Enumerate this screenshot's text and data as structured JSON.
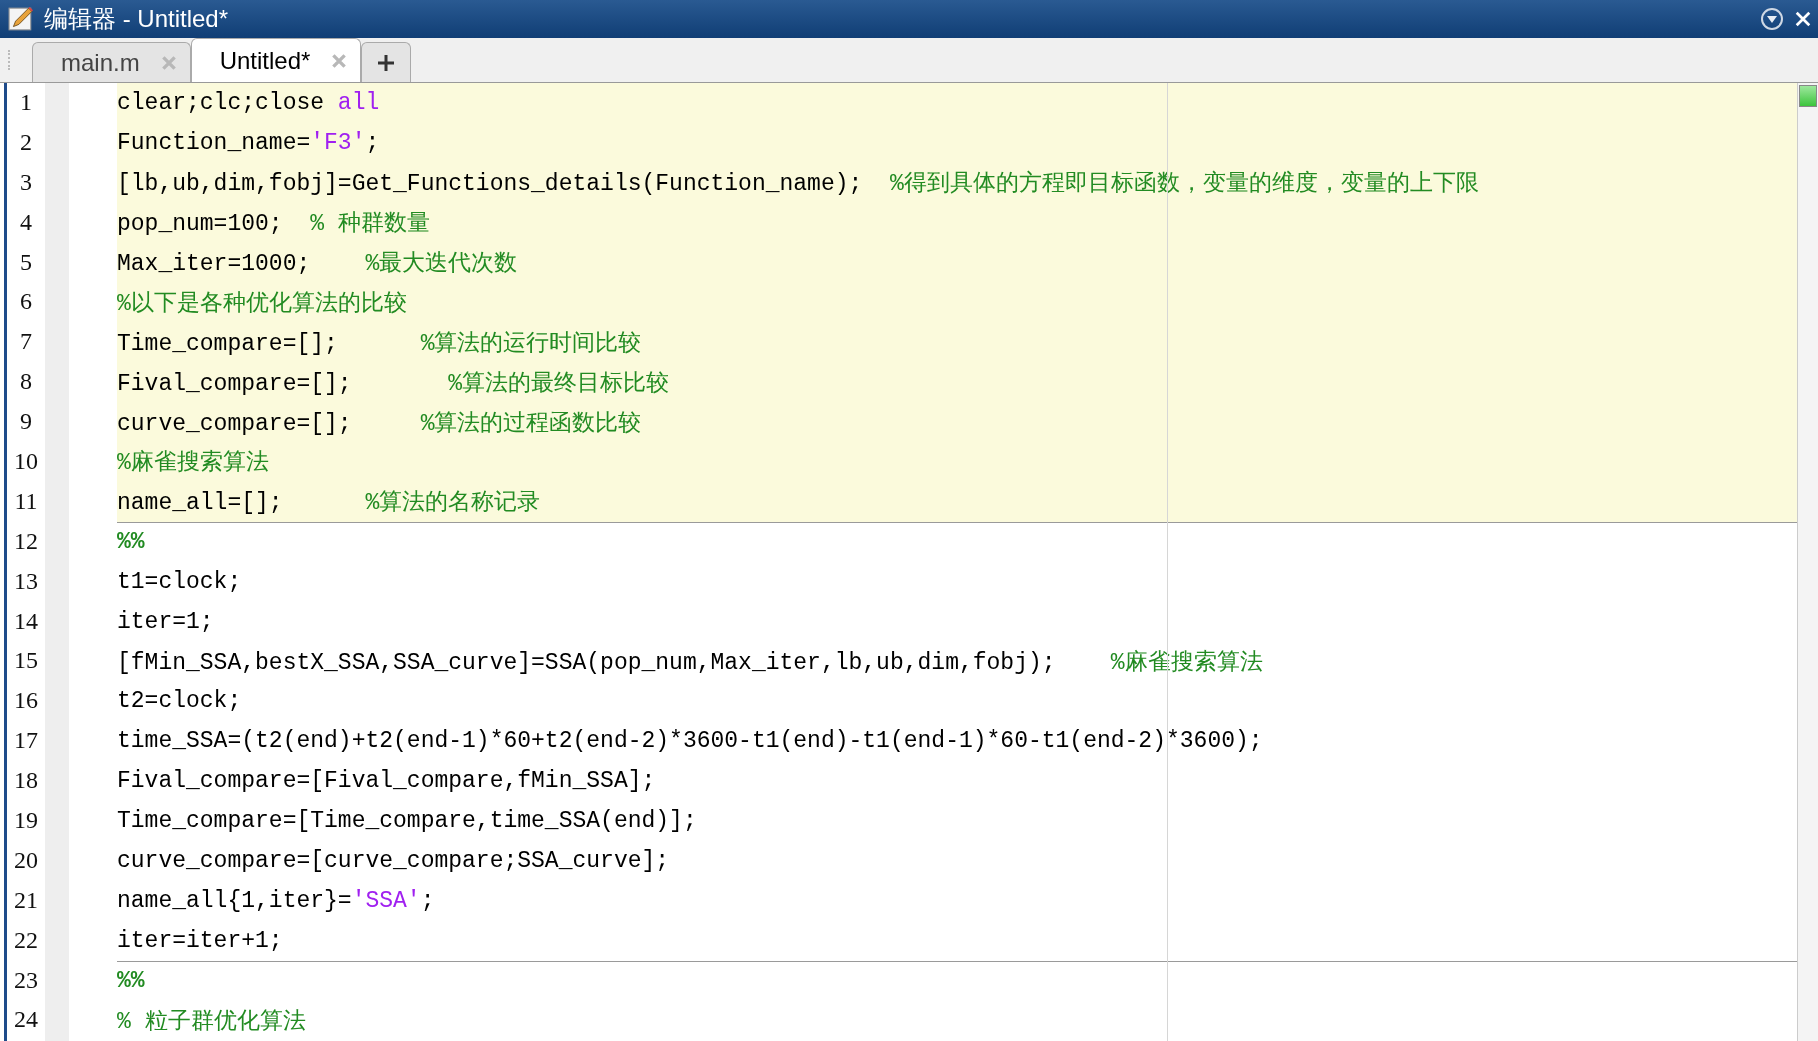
{
  "window": {
    "title": "编辑器 - Untitled*"
  },
  "tabs": [
    {
      "label": "main.m",
      "selected": false
    },
    {
      "label": "Untitled*",
      "selected": true
    }
  ],
  "lines": [
    {
      "number": "1",
      "highlighted": true,
      "tokens": [
        {
          "kind": "code",
          "text": "clear;clc;close "
        },
        {
          "kind": "string",
          "text": "all"
        }
      ]
    },
    {
      "number": "2",
      "highlighted": true,
      "tokens": [
        {
          "kind": "code",
          "text": "Function_name="
        },
        {
          "kind": "string",
          "text": "'F3'"
        },
        {
          "kind": "code",
          "text": ";"
        }
      ]
    },
    {
      "number": "3",
      "highlighted": true,
      "tokens": [
        {
          "kind": "code",
          "text": "[lb,ub,dim,fobj]=Get_Functions_details(Function_name);  "
        },
        {
          "kind": "comment",
          "text": "%得到具体的方程即目标函数，变量的维度，变量的上下限"
        }
      ]
    },
    {
      "number": "4",
      "highlighted": true,
      "tokens": [
        {
          "kind": "code",
          "text": "pop_num=100;  "
        },
        {
          "kind": "comment",
          "text": "% 种群数量"
        }
      ]
    },
    {
      "number": "5",
      "highlighted": true,
      "tokens": [
        {
          "kind": "code",
          "text": "Max_iter=1000;    "
        },
        {
          "kind": "comment",
          "text": "%最大迭代次数"
        }
      ]
    },
    {
      "number": "6",
      "highlighted": true,
      "tokens": [
        {
          "kind": "comment",
          "text": "%以下是各种优化算法的比较"
        }
      ]
    },
    {
      "number": "7",
      "highlighted": true,
      "tokens": [
        {
          "kind": "code",
          "text": "Time_compare=[];      "
        },
        {
          "kind": "comment",
          "text": "%算法的运行时间比较"
        }
      ]
    },
    {
      "number": "8",
      "highlighted": true,
      "tokens": [
        {
          "kind": "code",
          "text": "Fival_compare=[];       "
        },
        {
          "kind": "comment",
          "text": "%算法的最终目标比较"
        }
      ]
    },
    {
      "number": "9",
      "highlighted": true,
      "tokens": [
        {
          "kind": "code",
          "text": "curve_compare=[];     "
        },
        {
          "kind": "comment",
          "text": "%算法的过程函数比较"
        }
      ]
    },
    {
      "number": "10",
      "highlighted": true,
      "tokens": [
        {
          "kind": "comment",
          "text": "%麻雀搜索算法"
        }
      ]
    },
    {
      "number": "11",
      "highlighted": true,
      "tokens": [
        {
          "kind": "code",
          "text": "name_all=[];      "
        },
        {
          "kind": "comment",
          "text": "%算法的名称记录"
        }
      ]
    },
    {
      "number": "12",
      "highlighted": false,
      "tokens": [
        {
          "kind": "section",
          "text": "%%"
        }
      ]
    },
    {
      "number": "13",
      "highlighted": false,
      "tokens": [
        {
          "kind": "code",
          "text": "t1=clock;"
        }
      ]
    },
    {
      "number": "14",
      "highlighted": false,
      "tokens": [
        {
          "kind": "code",
          "text": "iter=1;"
        }
      ]
    },
    {
      "number": "15",
      "highlighted": false,
      "tokens": [
        {
          "kind": "code",
          "text": "[fMin_SSA,bestX_SSA,SSA_curve]=SSA(pop_num,Max_iter,lb,ub,dim,fobj);    "
        },
        {
          "kind": "comment",
          "text": "%麻雀搜索算法"
        }
      ]
    },
    {
      "number": "16",
      "highlighted": false,
      "tokens": [
        {
          "kind": "code",
          "text": "t2=clock;"
        }
      ]
    },
    {
      "number": "17",
      "highlighted": false,
      "tokens": [
        {
          "kind": "code",
          "text": "time_SSA=(t2(end)+t2(end-1)*60+t2(end-2)*3600-t1(end)-t1(end-1)*60-t1(end-2)*3600);"
        }
      ]
    },
    {
      "number": "18",
      "highlighted": false,
      "tokens": [
        {
          "kind": "code",
          "text": "Fival_compare=[Fival_compare,fMin_SSA];"
        }
      ]
    },
    {
      "number": "19",
      "highlighted": false,
      "tokens": [
        {
          "kind": "code",
          "text": "Time_compare=[Time_compare,time_SSA(end)];"
        }
      ]
    },
    {
      "number": "20",
      "highlighted": false,
      "tokens": [
        {
          "kind": "code",
          "text": "curve_compare=[curve_compare;SSA_curve];"
        }
      ]
    },
    {
      "number": "21",
      "highlighted": false,
      "tokens": [
        {
          "kind": "code",
          "text": "name_all{1,iter}="
        },
        {
          "kind": "string",
          "text": "'SSA'"
        },
        {
          "kind": "code",
          "text": ";"
        }
      ]
    },
    {
      "number": "22",
      "highlighted": false,
      "tokens": [
        {
          "kind": "code",
          "text": "iter=iter+1;"
        }
      ]
    },
    {
      "number": "23",
      "highlighted": false,
      "tokens": [
        {
          "kind": "section",
          "text": "%%"
        }
      ]
    },
    {
      "number": "24",
      "highlighted": false,
      "tokens": [
        {
          "kind": "comment",
          "text": "% 粒子群优化算法"
        }
      ]
    }
  ]
}
